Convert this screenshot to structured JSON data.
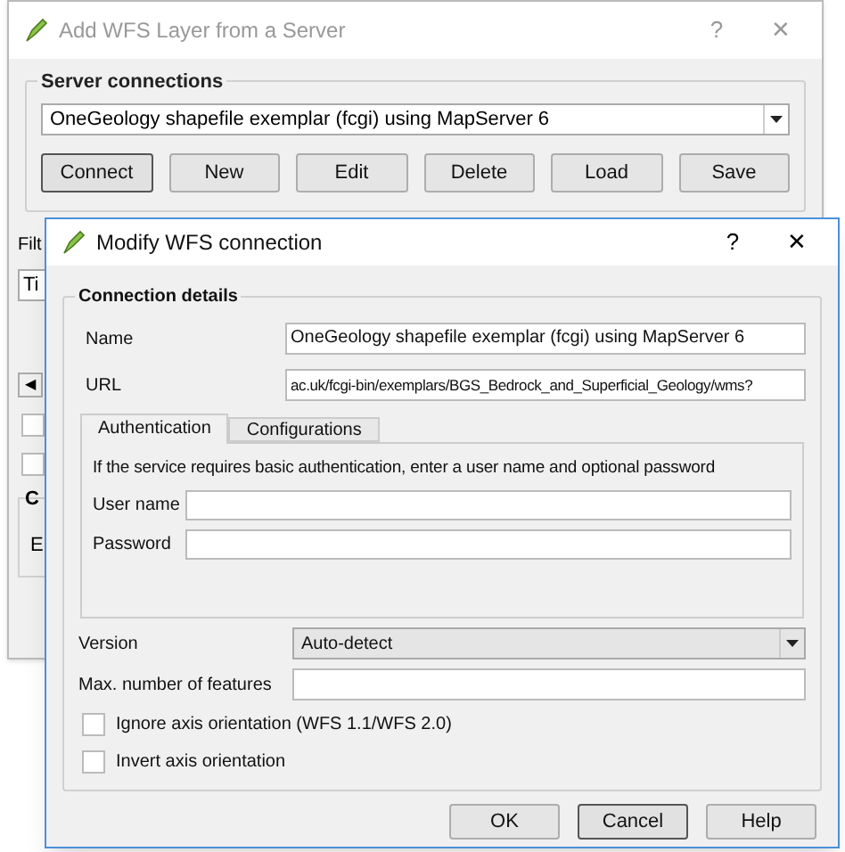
{
  "back_window": {
    "title": "Add WFS Layer from a Server",
    "help": "?",
    "close": "✕",
    "server_connections": {
      "title": "Server connections",
      "connection": "OneGeology shapefile exemplar (fcgi) using MapServer 6",
      "buttons": [
        {
          "label": "Connect",
          "focused": true
        },
        {
          "label": "New",
          "focused": false
        },
        {
          "label": "Edit",
          "focused": false
        },
        {
          "label": "Delete",
          "focused": false
        },
        {
          "label": "Load",
          "focused": false
        },
        {
          "label": "Save",
          "focused": false
        }
      ]
    },
    "filter_label": "Filt",
    "table_header": "Ti",
    "scroll_arrow": "◀",
    "checkboxes": [
      {
        "checked": false
      },
      {
        "checked": false
      }
    ],
    "group_title": "C",
    "group_text": "E"
  },
  "dialog": {
    "title": "Modify WFS connection",
    "help": "?",
    "close": "✕",
    "group_title": "Connection details",
    "name": {
      "label": "Name",
      "value": "OneGeology shapefile exemplar (fcgi) using MapServer 6"
    },
    "url": {
      "label": "URL",
      "value": "ac.uk/fcgi-bin/exemplars/BGS_Bedrock_and_Superficial_Geology/wms?"
    },
    "tabs": [
      {
        "label": "Authentication",
        "selected": true
      },
      {
        "label": "Configurations",
        "selected": false
      }
    ],
    "auth_hint": "If the service requires basic authentication, enter a user name and optional password",
    "auth_fields": [
      {
        "label": "User name"
      },
      {
        "label": "Password"
      }
    ],
    "version": {
      "label": "Version",
      "value": "Auto-detect"
    },
    "max_features": {
      "label": "Max. number of features"
    },
    "options": [
      {
        "label": "Ignore axis orientation (WFS 1.1/WFS 2.0)",
        "checked": false
      },
      {
        "label": "Invert axis orientation",
        "checked": false
      }
    ],
    "buttons": [
      {
        "label": "OK",
        "focused": false
      },
      {
        "label": "Cancel",
        "focused": true
      },
      {
        "label": "Help",
        "focused": false
      }
    ]
  }
}
